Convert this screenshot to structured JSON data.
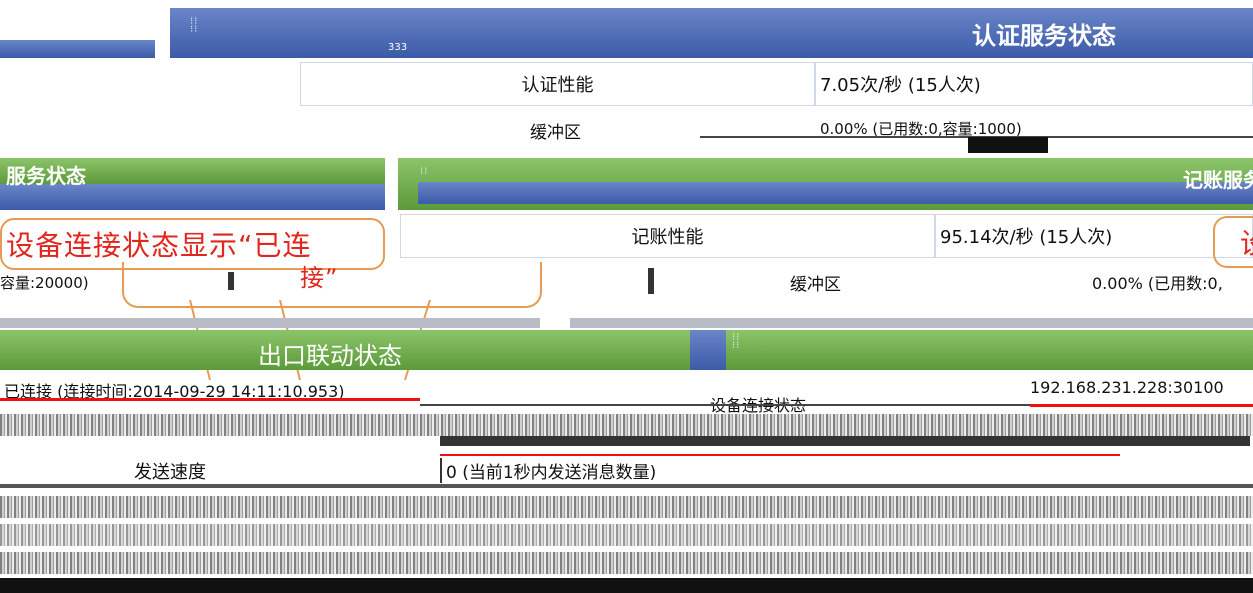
{
  "auth": {
    "title": "认证服务状态",
    "header_tag": "333",
    "perf_label": "认证性能",
    "perf_value": "7.05次/秒 (15人次)",
    "buffer_label": "缓冲区",
    "buffer_value": "0.00% (已用数:0,容量:1000)"
  },
  "service_status": {
    "title": "服务状态"
  },
  "accounting": {
    "title": "记账服务状态",
    "perf_label": "记账性能",
    "perf_value": "95.14次/秒 (15人次)",
    "buffer_label": "缓冲区",
    "buffer_value": "0.00% (已用数:0,",
    "left_capacity": "容量:20000)"
  },
  "callout": {
    "line1": "设备连接状态显示“已连",
    "line2": "接”",
    "right_char": "设"
  },
  "export": {
    "title": "出口联动状态",
    "connection_status": "已连接 (连接时间:2014-09-29 14:11:10.953)",
    "connection_label": "设备连接状态",
    "address": "192.168.231.228:30100",
    "send_speed_label": "发送速度",
    "send_speed_value": "0 (当前1秒内发送消息数量)"
  },
  "colors": {
    "blue_header": "#3b5aa8",
    "green_header": "#5c9a3a",
    "callout_border": "#e79a54",
    "callout_text": "#e0261e"
  }
}
